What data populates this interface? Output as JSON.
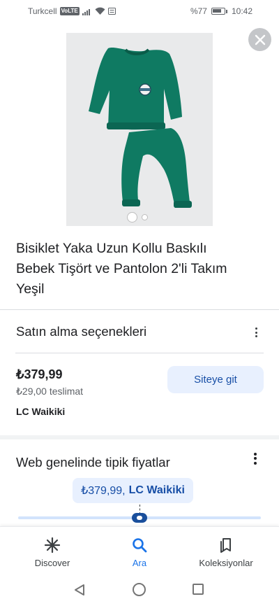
{
  "status_bar": {
    "carrier": "Turkcell",
    "network_badge": "VoLTE",
    "battery_text": "%77",
    "time": "10:42"
  },
  "product": {
    "title": "Bisiklet Yaka Uzun Kollu Baskılı Bebek Tişört ve Pantolon 2'li Takım Yeşil",
    "image_icon": "green-baby-set-image",
    "image_count": 2,
    "active_image_index": 1
  },
  "purchase": {
    "section_title": "Satın alma seçenekleri",
    "price": "₺379,99",
    "shipping": "₺29,00 teslimat",
    "merchant": "LC Waikiki",
    "site_button": "Siteye git"
  },
  "typical_prices": {
    "section_title": "Web genelinde tipik fiyatlar",
    "chip_price": "₺379,99,",
    "chip_merchant": "LC Waikiki"
  },
  "bottom_nav": {
    "items": [
      {
        "label": "Discover",
        "icon": "asterisk-icon",
        "active": false
      },
      {
        "label": "Ara",
        "icon": "search-icon",
        "active": true
      },
      {
        "label": "Koleksiyonlar",
        "icon": "bookmarks-icon",
        "active": false
      }
    ]
  },
  "colors": {
    "accent": "#1a73e8",
    "chip_bg": "#e8f0fe",
    "chip_text": "#174ea6",
    "product_green": "#0f7a62"
  }
}
